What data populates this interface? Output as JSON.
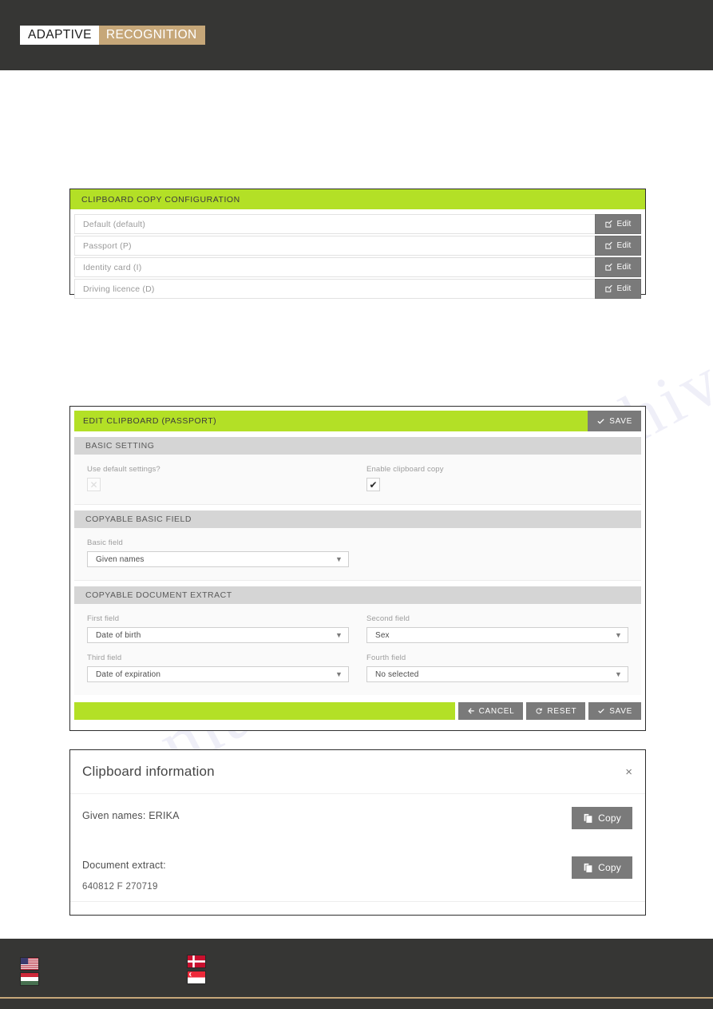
{
  "brand": {
    "left": "ADAPTIVE",
    "right": "RECOGNITION",
    "bar_color": "#363634",
    "accent_color": "#c6a779"
  },
  "theme": {
    "green": "#b3e026",
    "dark_button": "#7a7a7a",
    "section_head": "#d5d5d5"
  },
  "watermark": {
    "line1": "manualshive.com",
    "line2": "manualshive"
  },
  "config_panel": {
    "title": "CLIPBOARD COPY CONFIGURATION",
    "edit_label": "Edit",
    "edit_icon": "pencil-square-icon",
    "rows": [
      {
        "label": "Default (default)"
      },
      {
        "label": "Passport (P)"
      },
      {
        "label": "Identity card (I)"
      },
      {
        "label": "Driving licence (D)"
      }
    ]
  },
  "edit_panel": {
    "title": "EDIT CLIPBOARD (PASSPORT)",
    "save_label": "SAVE",
    "save_icon": "check-icon",
    "basic_setting": {
      "heading": "BASIC SETTING",
      "use_default_label": "Use default settings?",
      "use_default_checked": false,
      "enable_copy_label": "Enable clipboard copy",
      "enable_copy_checked": true,
      "check_glyph": "✔"
    },
    "copyable_basic_field": {
      "heading": "COPYABLE BASIC FIELD",
      "field_label": "Basic field",
      "value": "Given names"
    },
    "copyable_document_extract": {
      "heading": "COPYABLE DOCUMENT EXTRACT",
      "fields": [
        {
          "label": "First field",
          "value": "Date of birth"
        },
        {
          "label": "Second field",
          "value": "Sex"
        },
        {
          "label": "Third field",
          "value": "Date of expiration"
        },
        {
          "label": "Fourth field",
          "value": "No selected"
        }
      ]
    },
    "footer": {
      "cancel_label": "CANCEL",
      "cancel_icon": "arrow-left-icon",
      "reset_label": "RESET",
      "reset_icon": "refresh-icon",
      "save_label": "SAVE",
      "save_icon": "check-icon"
    }
  },
  "modal": {
    "title": "Clipboard information",
    "close_glyph": "×",
    "rows": [
      {
        "text": "Given names: ERIKA",
        "copy_label": "Copy",
        "sub": ""
      },
      {
        "text": "Document extract:",
        "copy_label": "Copy",
        "sub": "640812 F 270719"
      }
    ]
  },
  "footer_flags": [
    {
      "name": "flag-us",
      "country": "United States"
    },
    {
      "name": "flag-hu",
      "country": "Hungary"
    },
    {
      "name": "flag-dk",
      "country": "Denmark"
    },
    {
      "name": "flag-sg",
      "country": "Singapore"
    }
  ]
}
